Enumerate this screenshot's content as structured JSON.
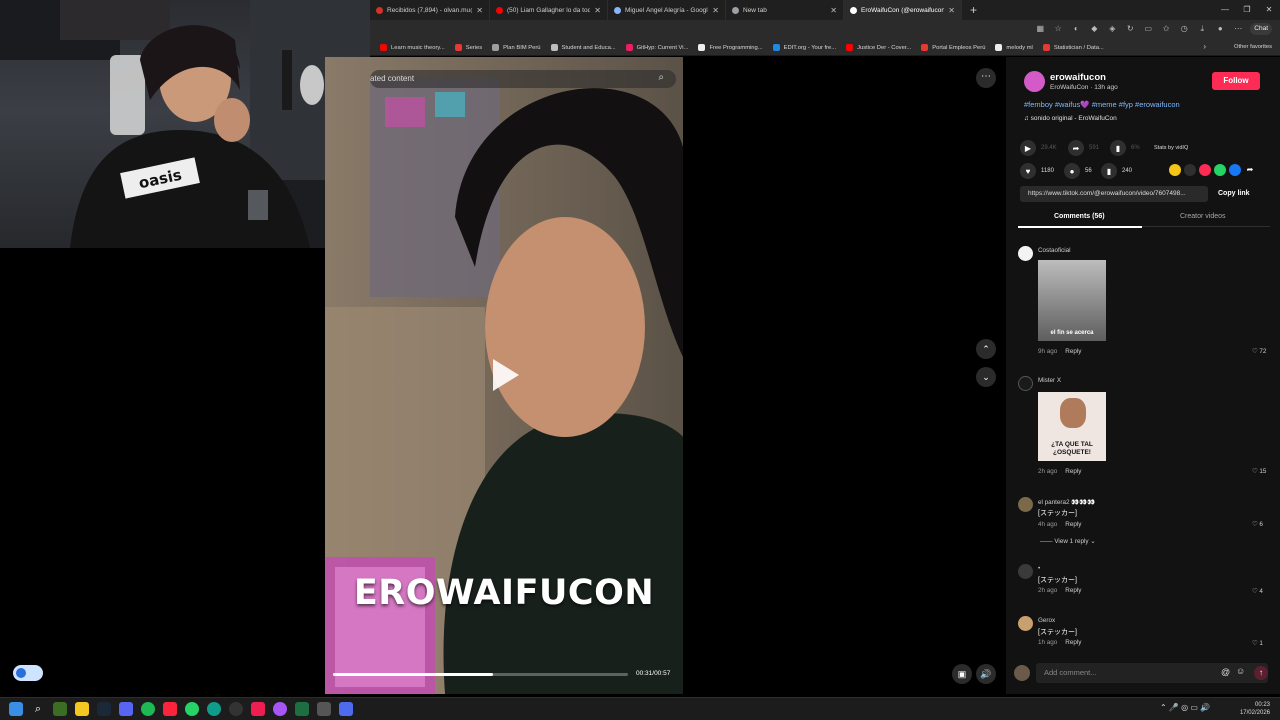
{
  "browser": {
    "tabs": [
      {
        "label": "Recibidos (7,894) - olvan.mu@gm",
        "color": "#d93025"
      },
      {
        "label": "(50) Liam Gallagher lo da todo co",
        "color": "#ff0000"
      },
      {
        "label": "Miguel Ángel Alegría - Google Se",
        "color": "#8ab4f8"
      },
      {
        "label": "New tab",
        "color": "#9aa0a6"
      },
      {
        "label": "EroWaifuCon (@erowaifucon) | Tik",
        "color": "#ffffff"
      }
    ],
    "new_tab_icon": "+",
    "chat_label": "Chat",
    "bookmarks": [
      {
        "label": "Learn music theory...",
        "color": "#ff0000"
      },
      {
        "label": "Series",
        "color": "#e53935"
      },
      {
        "label": "Plan BIM Perú",
        "color": "#9e9e9e"
      },
      {
        "label": "Student and Educa...",
        "color": "#bdbdbd"
      },
      {
        "label": "GitHyp: Current Vi...",
        "color": "#e91e63"
      },
      {
        "label": "Free Programming...",
        "color": "#eeeeee"
      },
      {
        "label": "EDIT.org - Your fre...",
        "color": "#1e88e5"
      },
      {
        "label": "Justice Der - Cover...",
        "color": "#ff0000"
      },
      {
        "label": "Portal Empleos Perú",
        "color": "#e53935"
      },
      {
        "label": "melody ml",
        "color": "#eeeeee"
      },
      {
        "label": "Statistician / Data...",
        "color": "#e53935"
      }
    ],
    "other_favorites": "Other favorites"
  },
  "video": {
    "search_placeholder": "ated content",
    "overlay_text": "EROWAIFUCON",
    "time": "00:31/00:57",
    "progress": 0.544
  },
  "post": {
    "username": "erowaifucon",
    "handle_meta": "EroWaifuCon · 13h ago",
    "follow_label": "Follow",
    "hashtags": "#femboy #waifus💜 #meme #fyp #erowaifucon",
    "sound": "♫  sonido original - EroWaifuCon",
    "views": "29.4K",
    "shares_stat": "591",
    "percent": "6%",
    "stats_by": "Stats by vidIQ",
    "likes": "1180",
    "comments_count": "56",
    "saves": "240",
    "link": "https://www.tiktok.com/@erowaifucon/video/7607498...",
    "copy_link": "Copy link",
    "tab_comments": "Comments (56)",
    "tab_creator": "Creator videos",
    "add_comment_placeholder": "Add comment..."
  },
  "comments": [
    {
      "name": "Costaoficial",
      "body": "",
      "sticker": "el fin se acerca",
      "time": "9h ago",
      "reply": "Reply",
      "likes": "♡ 72"
    },
    {
      "name": "Mister X",
      "body": "",
      "sticker": "¿TA QUE TAL ¿OSQUETE!",
      "time": "2h ago",
      "reply": "Reply",
      "likes": "♡ 15"
    },
    {
      "name": "el pantera2 👀👀👀",
      "body": "[ステッカー]",
      "time": "4h ago",
      "reply": "Reply",
      "likes": "♡ 6",
      "view_replies": "View 1 reply ⌄"
    },
    {
      "name": "•",
      "body": "[ステッカー]",
      "time": "2h ago",
      "reply": "Reply",
      "likes": "♡ 4"
    },
    {
      "name": "Gerox",
      "body": "[ステッカー]",
      "time": "1h ago",
      "reply": "Reply",
      "likes": "♡ 1"
    }
  ],
  "taskbar": {
    "time": "00:23",
    "date": "17/02/2026"
  },
  "colors": {
    "accent": "#fe2c55",
    "hashtag": "#7fb8ff"
  }
}
